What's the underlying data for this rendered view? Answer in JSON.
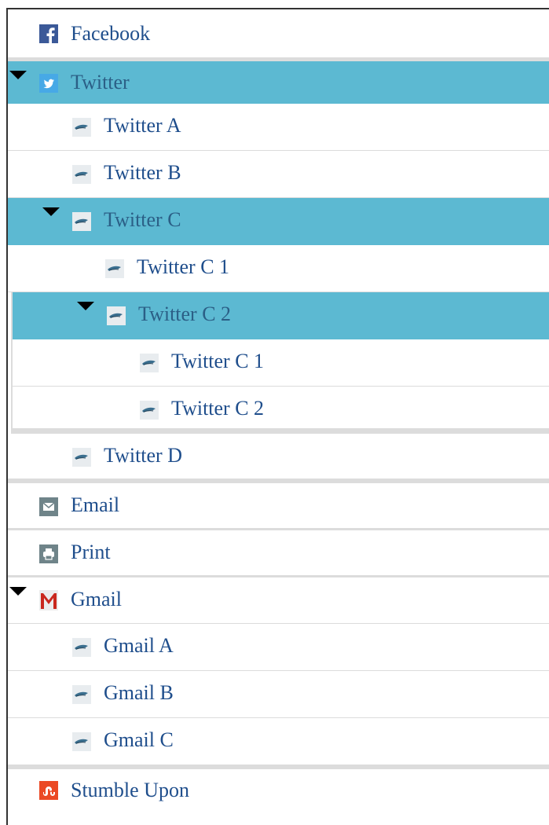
{
  "tree": {
    "facebook": {
      "label": "Facebook",
      "icon": "facebook-icon"
    },
    "twitter": {
      "label": "Twitter",
      "icon": "twitter-icon",
      "children": {
        "a": {
          "label": "Twitter A"
        },
        "b": {
          "label": "Twitter B"
        },
        "c": {
          "label": "Twitter C",
          "children": {
            "c1": {
              "label": "Twitter C 1"
            },
            "c2": {
              "label": "Twitter C 2",
              "children": {
                "c1": {
                  "label": "Twitter C 1"
                },
                "c2": {
                  "label": "Twitter C 2"
                }
              }
            }
          }
        },
        "d": {
          "label": "Twitter D"
        }
      }
    },
    "email": {
      "label": "Email",
      "icon": "envelope-icon"
    },
    "print": {
      "label": "Print",
      "icon": "printer-icon"
    },
    "gmail": {
      "label": "Gmail",
      "icon": "gmail-icon",
      "children": {
        "a": {
          "label": "Gmail A"
        },
        "b": {
          "label": "Gmail B"
        },
        "c": {
          "label": "Gmail C"
        }
      }
    },
    "stumbleupon": {
      "label": "Stumble Upon",
      "icon": "stumbleupon-icon"
    }
  },
  "colors": {
    "selected_bg": "#5cb9d2",
    "link_text": "#1f4e8c",
    "separator": "#dcdcdc"
  }
}
